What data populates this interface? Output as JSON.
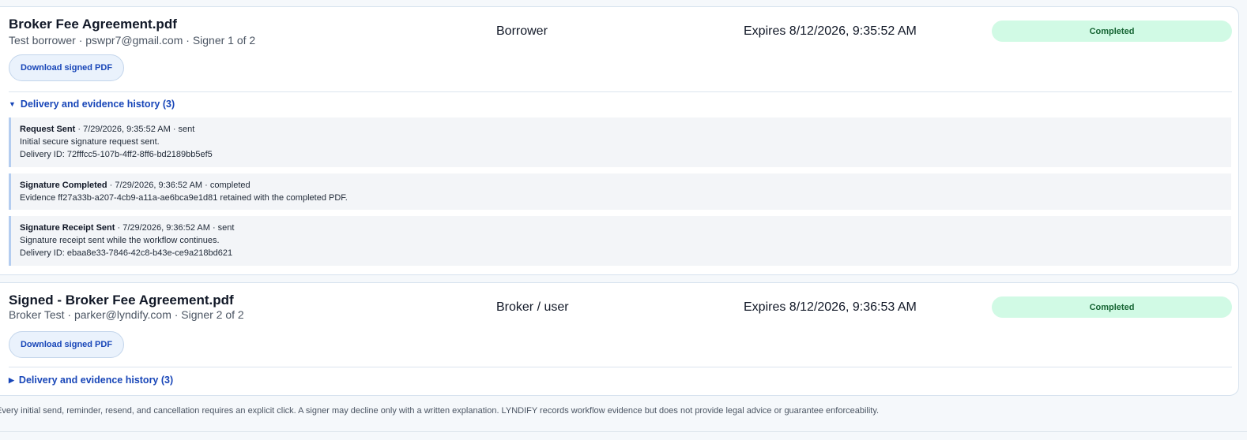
{
  "signers": [
    {
      "document": "Broker Fee Agreement.pdf",
      "signer_line": "Test borrower · pswpr7@gmail.com · Signer 1 of 2",
      "role": "Borrower",
      "expires": "Expires 8/12/2026, 9:35:52 AM",
      "status": "Completed",
      "download_label": "Download signed PDF",
      "history_label": "Delivery and evidence history (3)",
      "history_expanded": true,
      "events": [
        {
          "title": "Request Sent",
          "meta": " · 7/29/2026, 9:35:52 AM · sent",
          "description": "Initial secure signature request sent.",
          "delivery": "Delivery ID: 72fffcc5-107b-4ff2-8ff6-bd2189bb5ef5"
        },
        {
          "title": "Signature Completed",
          "meta": " · 7/29/2026, 9:36:52 AM · completed",
          "description": "Evidence ff27a33b-a207-4cb9-a11a-ae6bca9e1d81 retained with the completed PDF."
        },
        {
          "title": "Signature Receipt Sent",
          "meta": " · 7/29/2026, 9:36:52 AM · sent",
          "description": "Signature receipt sent while the workflow continues.",
          "delivery": "Delivery ID: ebaa8e33-7846-42c8-b43e-ce9a218bd621"
        }
      ]
    },
    {
      "document": "Signed - Broker Fee Agreement.pdf",
      "signer_line": "Broker Test · parker@lyndify.com · Signer 2 of 2",
      "role": "Broker / user",
      "expires": "Expires 8/12/2026, 9:36:53 AM",
      "status": "Completed",
      "download_label": "Download signed PDF",
      "history_label": "Delivery and evidence history (3)",
      "history_expanded": false
    }
  ],
  "icons": {
    "expanded": "triangle-down-icon",
    "collapsed": "triangle-right-icon",
    "expanded_glyph": "▼",
    "collapsed_glyph": "▶"
  },
  "footer_text": "Every initial send, reminder, resend, and cancellation requires an explicit click. A signer may decline only with a written explanation. LYNDIFY records workflow evidence but does not provide legal advice or guarantee enforceability.",
  "colors": {
    "accent": "#1846b8",
    "status_bg": "#d1fae5",
    "status_text": "#166534",
    "event_border": "#b4cdf0"
  }
}
